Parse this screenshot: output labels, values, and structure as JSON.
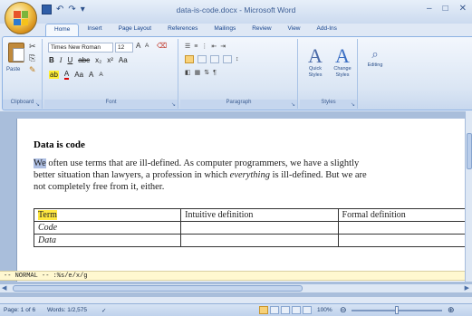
{
  "window": {
    "title": "data-is-code.docx - Microsoft Word",
    "controls": {
      "minimize": "–",
      "restore": "□",
      "close": "✕"
    }
  },
  "quick_access": {
    "undo": "↶",
    "redo": "↷",
    "customize": "▾"
  },
  "tabs": [
    "Home",
    "Insert",
    "Page Layout",
    "References",
    "Mailings",
    "Review",
    "View",
    "Add-Ins"
  ],
  "active_tab": "Home",
  "ribbon": {
    "clipboard": {
      "label": "Clipboard",
      "paste_label": "Paste"
    },
    "font": {
      "label": "Font",
      "font_name": "Times New Roman",
      "font_size": "12"
    },
    "paragraph": {
      "label": "Paragraph"
    },
    "styles": {
      "label": "Styles",
      "quick_styles": "Quick Styles",
      "change_styles": "Change Styles"
    },
    "editing": {
      "label": "Editing"
    }
  },
  "document": {
    "heading": "Data is code",
    "para_lines": [
      {
        "highlight": "We",
        "rest": " often use terms that are ill-defined. As computer programmers, we have a slightly"
      },
      {
        "before": "better situation than lawyers, a profession in which ",
        "italic": "everything",
        "after": " is ill-defined. But we are"
      },
      {
        "text": "not completely free from it, either."
      }
    ],
    "table": {
      "headers": [
        "Term",
        "Intuitive definition",
        "Formal definition"
      ],
      "rows": [
        [
          "Code",
          "",
          ""
        ],
        [
          "Data",
          "",
          ""
        ]
      ]
    },
    "command_line": "-- NORMAL --   :%s/e/x/g"
  },
  "status": {
    "page": "Page: 1 of 6",
    "words": "Words: 1/2,575",
    "zoom": "100%"
  }
}
